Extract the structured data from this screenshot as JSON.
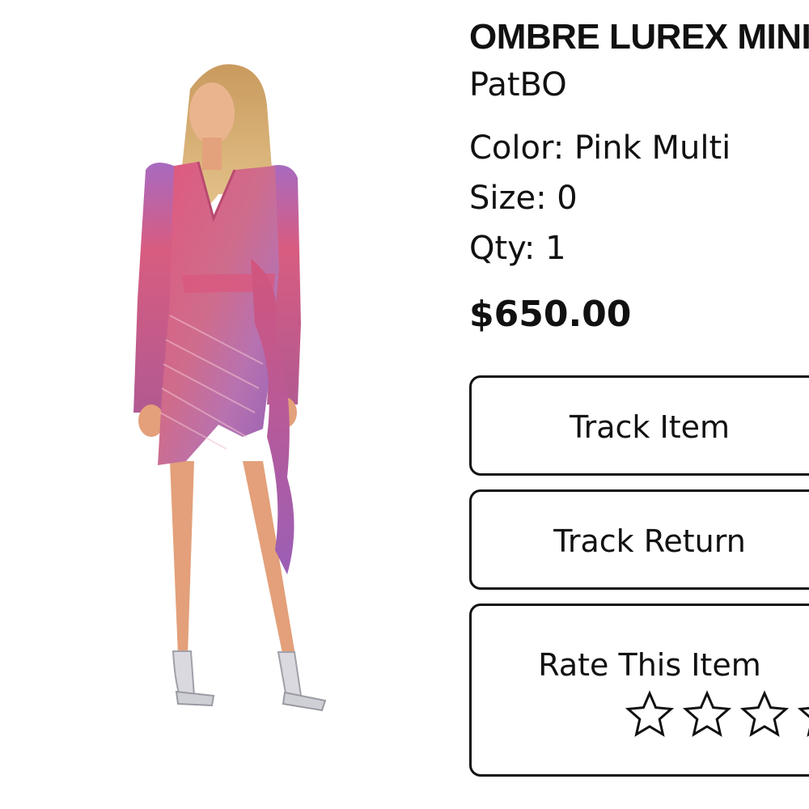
{
  "product": {
    "title": "OMBRE LUREX MINI DRESS",
    "brand": "PatBO",
    "color_label": "Color: Pink Multi",
    "size_label": "Size: 0",
    "qty_label": "Qty: 1",
    "price": "$650.00",
    "image_icon": "product-photo-dress"
  },
  "actions": {
    "track_item_label": "Track Item",
    "track_return_label": "Track Return"
  },
  "rating": {
    "label": "Rate This Item",
    "max_stars": 5,
    "current_rating": 0,
    "star_icon": "star-outline-icon"
  },
  "colors": {
    "text": "#111111",
    "background": "#ffffff",
    "dress_pink": "#d9577a",
    "dress_purple": "#9a62b8",
    "skin": "#e8a27a",
    "hair": "#d9b47a"
  }
}
